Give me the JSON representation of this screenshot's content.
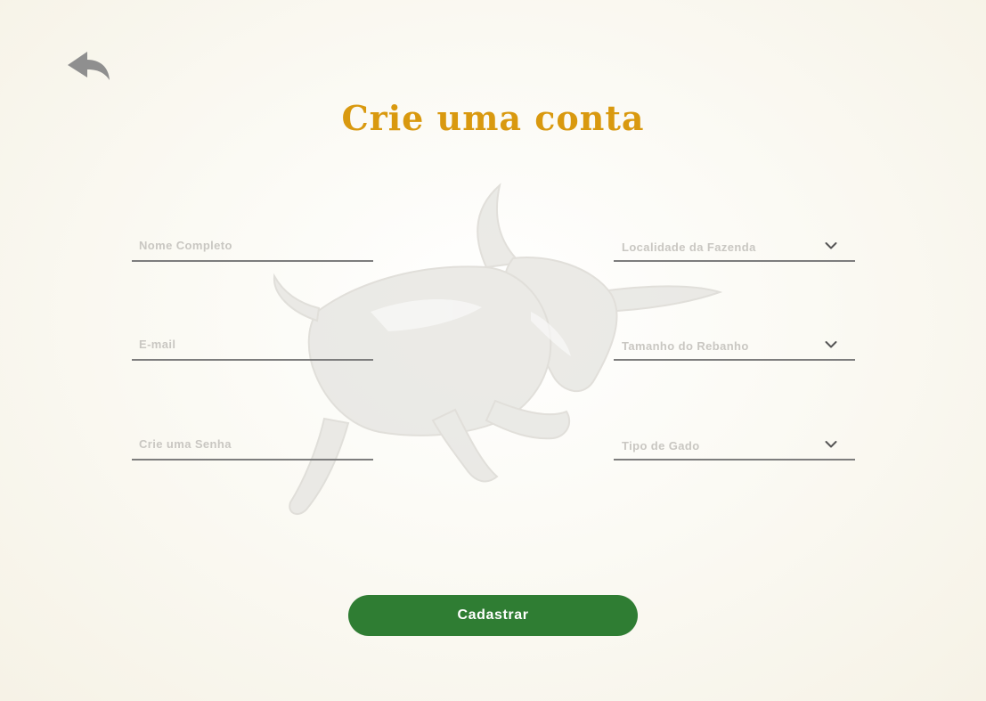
{
  "header": {
    "back_icon": "reply-arrow-icon",
    "title": "Crie uma conta"
  },
  "form": {
    "full_name": {
      "placeholder": "Nome Completo",
      "value": ""
    },
    "email": {
      "placeholder": "E-mail",
      "value": ""
    },
    "password": {
      "placeholder": "Crie uma Senha",
      "value": ""
    },
    "farm_location": {
      "label": "Localidade da Fazenda",
      "icon": "chevron-down-icon"
    },
    "herd_size": {
      "label": "Tamanho do Rebanho",
      "icon": "chevron-down-icon"
    },
    "cattle_type": {
      "label": "Tipo de Gado",
      "icon": "chevron-down-icon"
    }
  },
  "actions": {
    "submit_label": "Cadastrar"
  },
  "decoration": {
    "watermark_icon": "bull-icon"
  },
  "colors": {
    "title": "#d9990f",
    "primary_button": "#2f7d33",
    "underline": "#7d7d7d",
    "placeholder": "#c9c7c2"
  }
}
